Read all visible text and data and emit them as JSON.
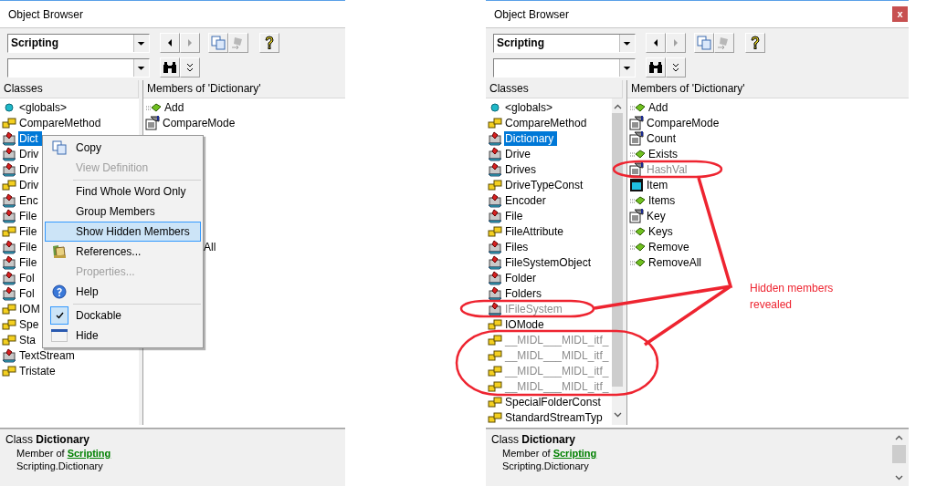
{
  "panels": [
    {
      "title": "Object Browser",
      "library": "Scripting",
      "classes_header": "Classes",
      "members_header": "Members of 'Dictionary'",
      "classes": [
        {
          "label": "<globals>",
          "kind": "globals",
          "selected": false,
          "hidden": false
        },
        {
          "label": "CompareMethod",
          "kind": "enum",
          "selected": false,
          "hidden": false
        },
        {
          "label": "Dict",
          "kind": "class",
          "selected": true,
          "hidden": false
        },
        {
          "label": "Driv",
          "kind": "class",
          "selected": false,
          "hidden": false
        },
        {
          "label": "Driv",
          "kind": "class",
          "selected": false,
          "hidden": false
        },
        {
          "label": "Driv",
          "kind": "enum",
          "selected": false,
          "hidden": false
        },
        {
          "label": "Enc",
          "kind": "class",
          "selected": false,
          "hidden": false
        },
        {
          "label": "File",
          "kind": "class",
          "selected": false,
          "hidden": false
        },
        {
          "label": "File",
          "kind": "enum",
          "selected": false,
          "hidden": false
        },
        {
          "label": "File",
          "kind": "class",
          "selected": false,
          "hidden": false
        },
        {
          "label": "File",
          "kind": "class",
          "selected": false,
          "hidden": false
        },
        {
          "label": "Fol",
          "kind": "class",
          "selected": false,
          "hidden": false
        },
        {
          "label": "Fol",
          "kind": "class",
          "selected": false,
          "hidden": false
        },
        {
          "label": "IOM",
          "kind": "enum",
          "selected": false,
          "hidden": false
        },
        {
          "label": "Spe",
          "kind": "enum",
          "selected": false,
          "hidden": false
        },
        {
          "label": "Sta",
          "kind": "enum",
          "selected": false,
          "hidden": false
        },
        {
          "label": "TextStream",
          "kind": "class",
          "selected": false,
          "hidden": false
        },
        {
          "label": "Tristate",
          "kind": "enum",
          "selected": false,
          "hidden": false
        }
      ],
      "members": [
        {
          "label": "Add",
          "kind": "method",
          "hidden": false
        },
        {
          "label": "CompareMode",
          "kind": "property",
          "hidden": false
        }
      ],
      "members_beside_menu": [
        {
          "label": "All"
        }
      ],
      "context_menu": [
        {
          "kind": "item",
          "label": "Copy",
          "disabled": false,
          "selected": false
        },
        {
          "kind": "item",
          "label": "View Definition",
          "disabled": true,
          "selected": false
        },
        {
          "kind": "separator"
        },
        {
          "kind": "item",
          "label": "Find Whole Word Only",
          "disabled": false,
          "selected": false
        },
        {
          "kind": "item",
          "label": "Group Members",
          "disabled": false,
          "selected": false
        },
        {
          "kind": "item",
          "label": "Show Hidden Members",
          "disabled": false,
          "selected": true
        },
        {
          "kind": "item",
          "label": "References...",
          "disabled": false,
          "selected": false
        },
        {
          "kind": "item",
          "label": "Properties...",
          "disabled": true,
          "selected": false
        },
        {
          "kind": "item",
          "label": "Help",
          "disabled": false,
          "selected": false
        },
        {
          "kind": "separator"
        },
        {
          "kind": "check",
          "label": "Dockable",
          "checked": true,
          "disabled": false,
          "selected": false
        },
        {
          "kind": "item",
          "label": "Hide",
          "disabled": false,
          "selected": false
        }
      ],
      "info": {
        "title": "Class **Dictionary**",
        "member_of": "Member of",
        "library_link": "Scripting",
        "full_name": "Scripting.Dictionary"
      }
    },
    {
      "title": "Object Browser",
      "close": "x",
      "library": "Scripting",
      "classes_header": "Classes",
      "members_header": "Members of 'Dictionary'",
      "scrollbars": true,
      "classes": [
        {
          "label": "<globals>",
          "kind": "globals",
          "selected": false,
          "hidden": false
        },
        {
          "label": "CompareMethod",
          "kind": "enum",
          "selected": false,
          "hidden": false
        },
        {
          "label": "Dictionary",
          "kind": "class",
          "selected": true,
          "hidden": false
        },
        {
          "label": "Drive",
          "kind": "class",
          "selected": false,
          "hidden": false
        },
        {
          "label": "Drives",
          "kind": "class",
          "selected": false,
          "hidden": false
        },
        {
          "label": "DriveTypeConst",
          "kind": "enum",
          "selected": false,
          "hidden": false
        },
        {
          "label": "Encoder",
          "kind": "class",
          "selected": false,
          "hidden": false
        },
        {
          "label": "File",
          "kind": "class",
          "selected": false,
          "hidden": false
        },
        {
          "label": "FileAttribute",
          "kind": "enum",
          "selected": false,
          "hidden": false
        },
        {
          "label": "Files",
          "kind": "class",
          "selected": false,
          "hidden": false
        },
        {
          "label": "FileSystemObject",
          "kind": "class",
          "selected": false,
          "hidden": false
        },
        {
          "label": "Folder",
          "kind": "class",
          "selected": false,
          "hidden": false
        },
        {
          "label": "Folders",
          "kind": "class",
          "selected": false,
          "hidden": false
        },
        {
          "label": "IFileSystem",
          "kind": "class",
          "selected": false,
          "hidden": true
        },
        {
          "label": "IOMode",
          "kind": "enum",
          "selected": false,
          "hidden": false
        },
        {
          "label": "__MIDL___MIDL_itf_",
          "kind": "enum",
          "selected": false,
          "hidden": true
        },
        {
          "label": "__MIDL___MIDL_itf_",
          "kind": "enum",
          "selected": false,
          "hidden": true
        },
        {
          "label": "__MIDL___MIDL_itf_",
          "kind": "enum",
          "selected": false,
          "hidden": true
        },
        {
          "label": "__MIDL___MIDL_itf_",
          "kind": "enum",
          "selected": false,
          "hidden": true
        },
        {
          "label": "SpecialFolderConst",
          "kind": "enum",
          "selected": false,
          "hidden": false
        },
        {
          "label": "StandardStreamTyp",
          "kind": "enum",
          "selected": false,
          "hidden": false
        }
      ],
      "members": [
        {
          "label": "Add",
          "kind": "method",
          "hidden": false
        },
        {
          "label": "CompareMode",
          "kind": "property",
          "hidden": false
        },
        {
          "label": "Count",
          "kind": "property",
          "hidden": false
        },
        {
          "label": "Exists",
          "kind": "method",
          "hidden": false
        },
        {
          "label": "HashVal",
          "kind": "property",
          "hidden": true
        },
        {
          "label": "Item",
          "kind": "default",
          "hidden": false
        },
        {
          "label": "Items",
          "kind": "method",
          "hidden": false
        },
        {
          "label": "Key",
          "kind": "property",
          "hidden": false
        },
        {
          "label": "Keys",
          "kind": "method",
          "hidden": false
        },
        {
          "label": "Remove",
          "kind": "method",
          "hidden": false
        },
        {
          "label": "RemoveAll",
          "kind": "method",
          "hidden": false
        }
      ],
      "info": {
        "title": "Class **Dictionary**",
        "member_of": "Member of",
        "library_link": "Scripting",
        "full_name": "Scripting.Dictionary"
      }
    }
  ],
  "annotation": {
    "text": "Hidden members revealed"
  }
}
